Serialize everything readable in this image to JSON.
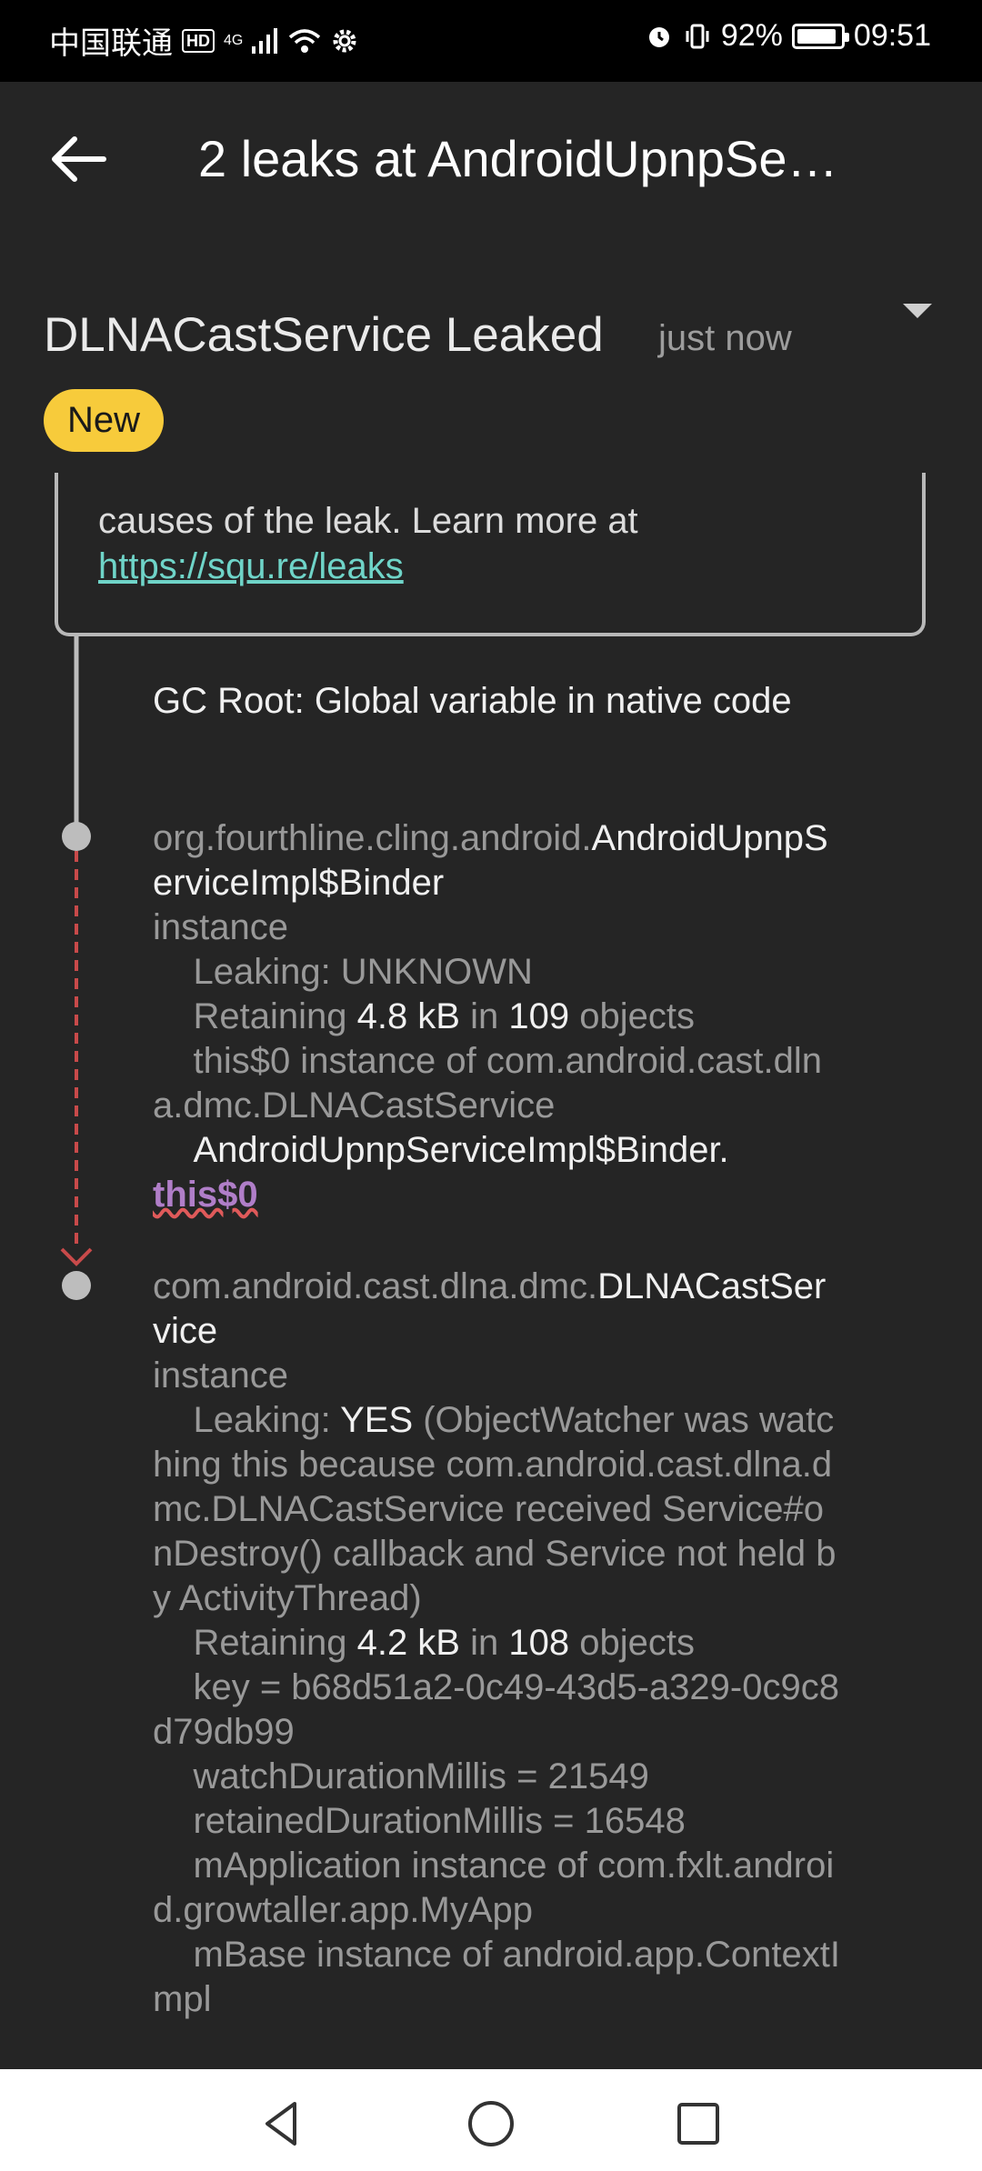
{
  "status": {
    "carrier": "中国联通",
    "hd": "HD",
    "network": "4G",
    "battery_pct": "92%",
    "battery_level": 0.92,
    "time": "09:51"
  },
  "appbar": {
    "title": "2 leaks at AndroidUpnpSe…"
  },
  "leak": {
    "title": "DLNACastService Leaked",
    "time": "just now",
    "badge": "New",
    "badge_color": "#f7cb3b"
  },
  "info": {
    "text": "causes of the leak. Learn more at",
    "link": "https://squ.re/leaks"
  },
  "trace": {
    "gc_root": "GC Root: Global variable in native code",
    "node1": {
      "pkg": "org.fourthline.cling.android.",
      "cls": "AndroidUpnpServiceImpl$Binder",
      "suffix": "instance",
      "leaking_label": "Leaking: ",
      "leaking_val": "UNKNOWN",
      "retaining_label": "Retaining ",
      "retaining_size": "4.8 kB",
      "retaining_in": " in ",
      "retaining_count": "109",
      "retaining_obj": " objects",
      "field_desc": "this$0 instance of com.android.cast.dlna.dmc.DLNACastService",
      "ref_owner": "AndroidUpnpServiceImpl$Binder.",
      "ref_field": "this$0"
    },
    "node2": {
      "pkg": "com.android.cast.dlna.dmc.",
      "cls": "DLNACastService",
      "suffix": "instance",
      "leaking_label": "Leaking: ",
      "leaking_val": "YES",
      "leaking_reason": " (ObjectWatcher was watching this because com.android.cast.dlna.dmc.DLNACastService received Service#onDestroy() callback and Service not held by ActivityThread)",
      "retaining_label": "Retaining ",
      "retaining_size": "4.2 kB",
      "retaining_in": " in ",
      "retaining_count": "108",
      "retaining_obj": " objects",
      "key": "key = b68d51a2-0c49-43d5-a329-0c9c8d79db99",
      "watch": "watchDurationMillis = 21549",
      "retained": "retainedDurationMillis = 16548",
      "mapp": "mApplication instance of com.fxlt.android.growtaller.app.MyApp",
      "mbase": "mBase instance of android.app.ContextImpl"
    }
  },
  "colors": {
    "background": "#252525",
    "link": "#6fd4c8",
    "reference": "#b07ec8",
    "leak_path": "#c84a4a"
  },
  "icons": {
    "back": "arrow-left-icon",
    "dropdown": "caret-down-icon",
    "nav_back": "triangle-back-icon",
    "nav_home": "circle-home-icon",
    "nav_recent": "square-recents-icon"
  }
}
